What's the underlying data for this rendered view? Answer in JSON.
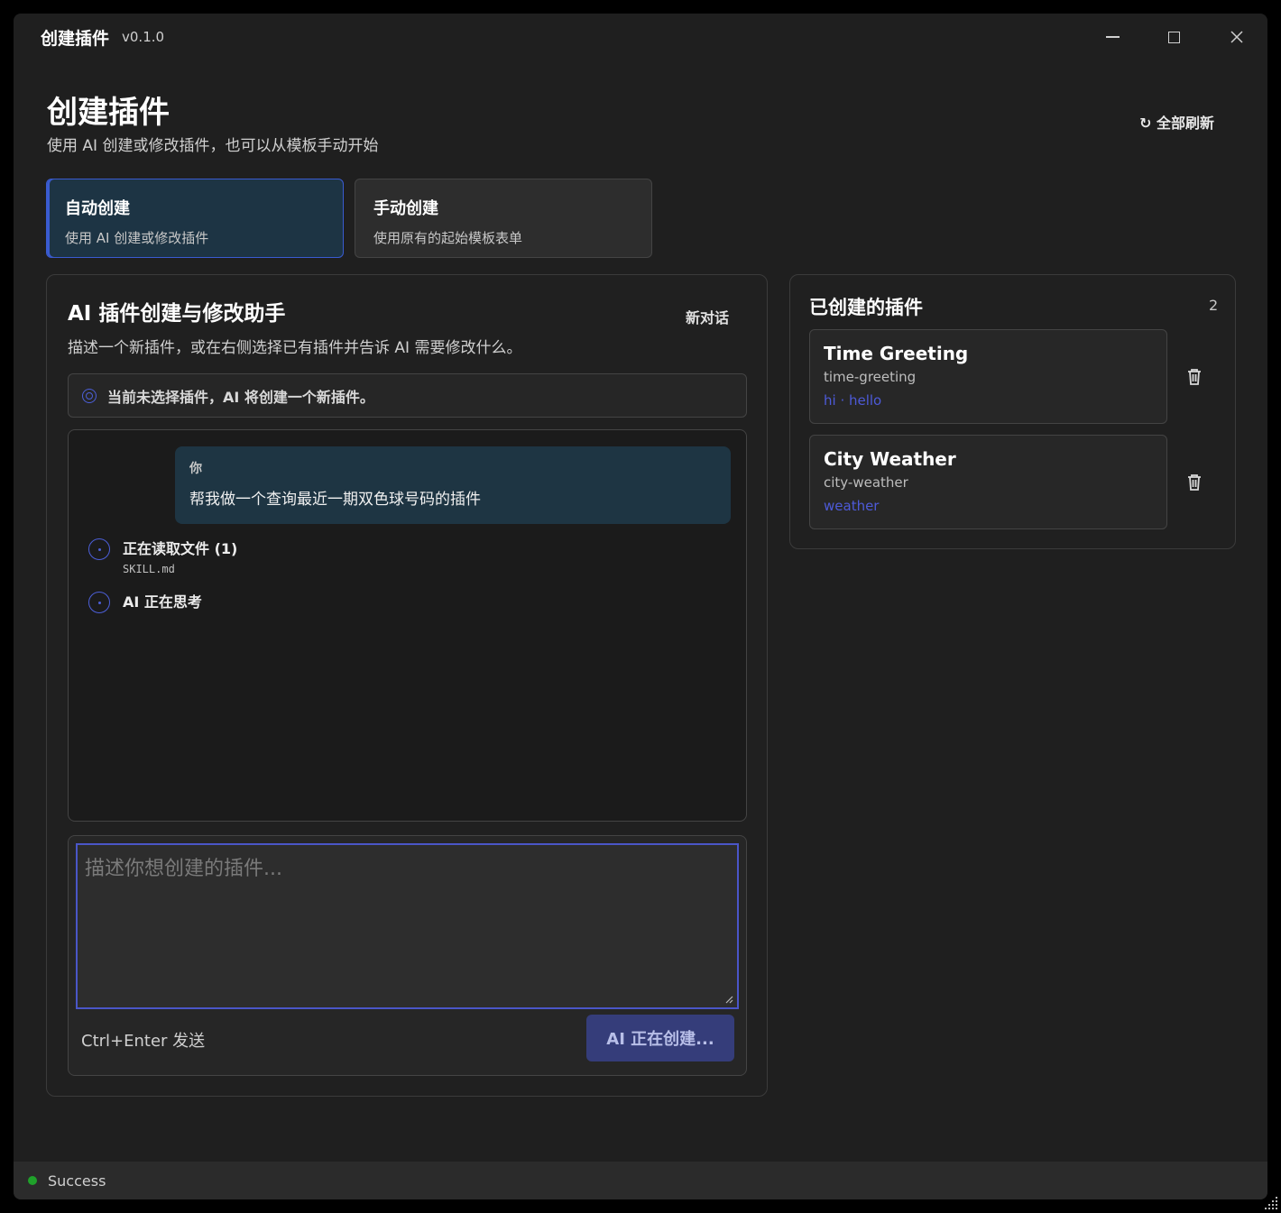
{
  "window": {
    "title": "创建插件",
    "version": "v0.1.0"
  },
  "header": {
    "title": "创建插件",
    "subtitle": "使用 AI 创建或修改插件，也可以从模板手动开始",
    "refresh_label": "↻ 全部刷新"
  },
  "modes": [
    {
      "title": "自动创建",
      "desc": "使用 AI 创建或修改插件",
      "selected": true
    },
    {
      "title": "手动创建",
      "desc": "使用原有的起始模板表单",
      "selected": false
    }
  ],
  "assistant": {
    "title": "AI 插件创建与修改助手",
    "new_chat_label": "新对话",
    "description": "描述一个新插件，或在右侧选择已有插件并告诉 AI 需要修改什么。",
    "status": "当前未选择插件，AI 将创建一个新插件。",
    "messages": [
      {
        "sender": "你",
        "text": "帮我做一个查询最近一期双色球号码的插件"
      }
    ],
    "steps": [
      {
        "title": "正在读取文件 (1)",
        "detail": "SKILL.md"
      },
      {
        "title": "AI 正在思考",
        "detail": ""
      }
    ],
    "input": {
      "value": "",
      "placeholder": "描述你想创建的插件..."
    },
    "send_hint": "Ctrl+Enter 发送",
    "send_button": "AI 正在创建..."
  },
  "plugins": {
    "title": "已创建的插件",
    "count": "2",
    "items": [
      {
        "name": "Time Greeting",
        "id": "time-greeting",
        "tags": "hi · hello"
      },
      {
        "name": "City Weather",
        "id": "city-weather",
        "tags": "weather"
      }
    ]
  },
  "statusbar": {
    "text": "Success"
  },
  "colors": {
    "accent": "#4a56c8",
    "selected_card_bg": "#1d3444",
    "success": "#1fa12a",
    "tag": "#4d5ad8"
  }
}
